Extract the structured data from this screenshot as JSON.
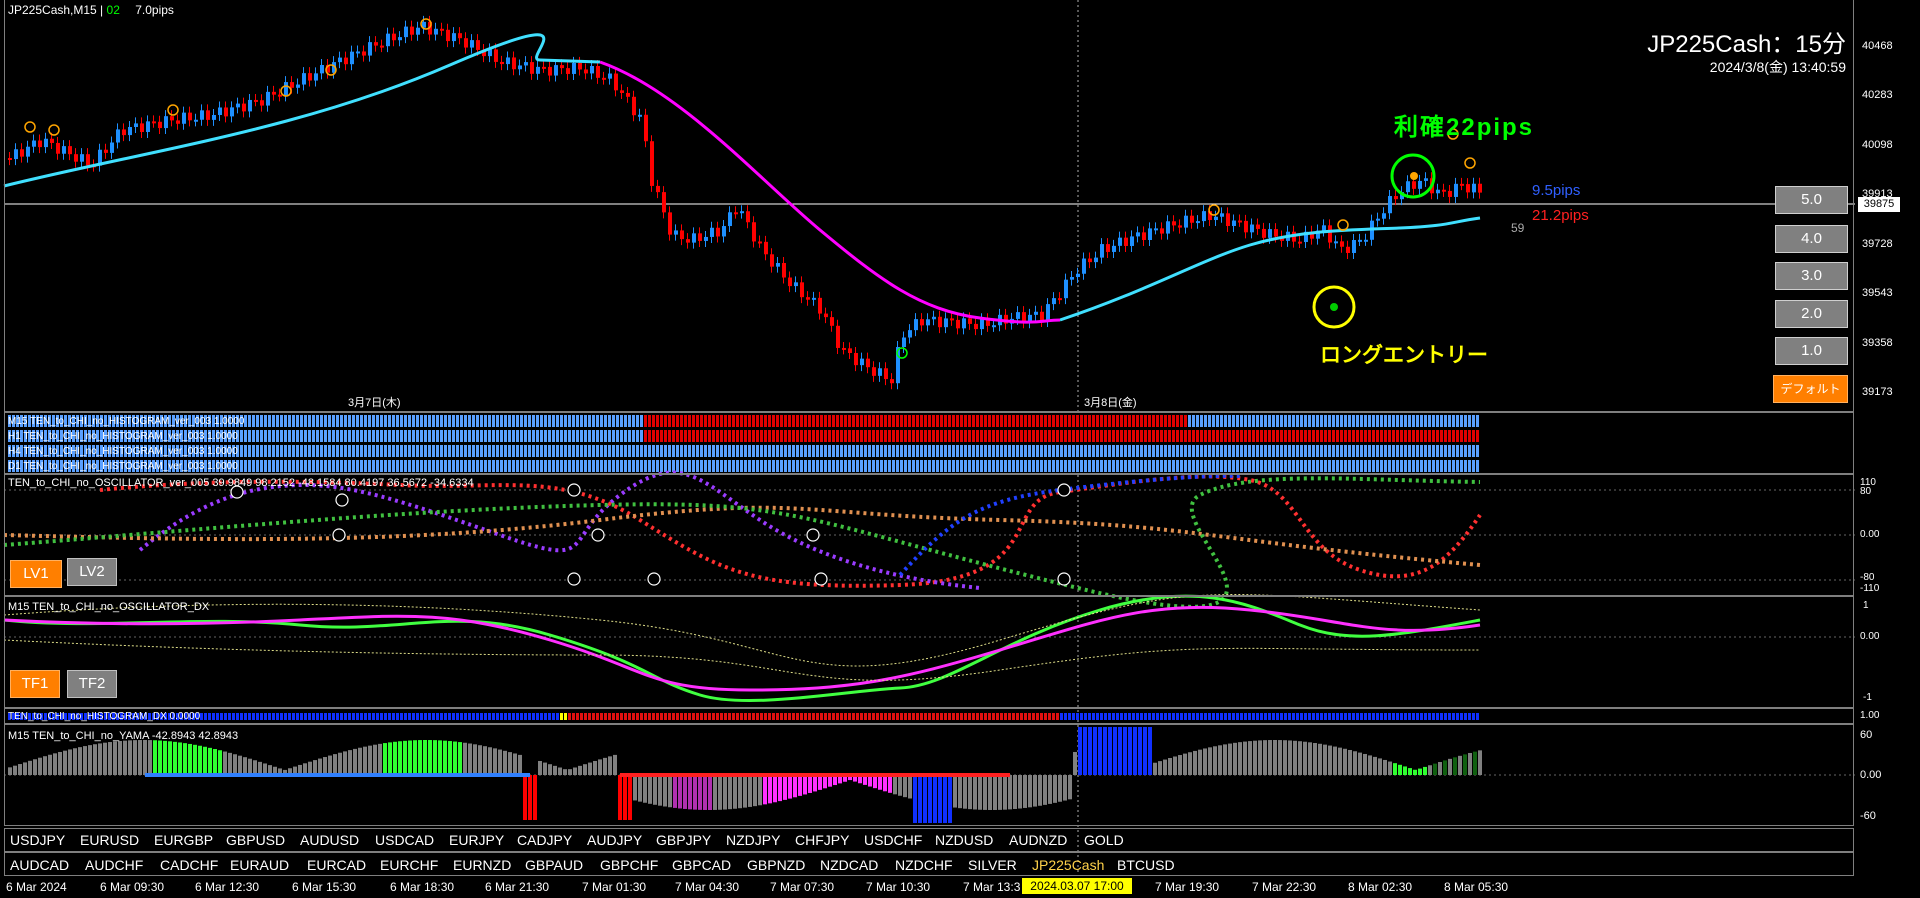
{
  "chart_header": {
    "symbol": "JP225Cash,M15",
    "bar_time": "02",
    "spread": "7.0pips"
  },
  "chart_title": {
    "title": "JP225Cash：15分",
    "datetime": "2024/3/8(金) 13:40:59"
  },
  "annotations": {
    "take_profit": "利確22pips",
    "long_entry": "ロングエントリー",
    "pips_blue": "9.5pips",
    "pips_red": "21.2pips",
    "seconds": "59"
  },
  "price_axis": {
    "labels": [
      "40468",
      "40283",
      "40098",
      "39913",
      "39728",
      "39543",
      "39358",
      "39173"
    ],
    "current_price": "39875"
  },
  "scale_buttons": [
    "5.0",
    "4.0",
    "3.0",
    "2.0",
    "1.0"
  ],
  "default_button": "デフォルト",
  "date_labels": [
    "3月7日(木)",
    "3月8日(金)"
  ],
  "histogram_rows": [
    "M15 TEN_to_CHI_no_HISTOGRAM_ver_003 1.0000",
    "H1 TEN_to_CHI_no_HISTOGRAM_ver_003 1.0000",
    "H4 TEN_to_CHI_no_HISTOGRAM_ver_003 1.0000",
    "D1 TEN_to_CHI_no_HISTOGRAM_ver_003 1.0000"
  ],
  "oscillator": {
    "title": "TEN_to_CHI_no_OSCILLATOR_ver_005 39.9849 98.2152 -48.1584 80.4197 36.5672 -34.6334",
    "levels": [
      "110",
      "80",
      "0.00",
      "-80",
      "-110"
    ],
    "buttons": [
      "LV1",
      "LV2"
    ]
  },
  "oscillator_dx": {
    "title": "M15 TEN_to_CHI_no_OSCILLATOR_DX",
    "levels": [
      "1",
      "0.00",
      "-1"
    ],
    "buttons": [
      "TF1",
      "TF2"
    ]
  },
  "histogram_dx": {
    "title": "TEN_to_CHI_no_HISTOGRAM_DX 0.0000",
    "level": "1.00"
  },
  "yama": {
    "title": "M15 TEN_to_CHI_no_YAMA -42.8943 42.8943",
    "levels": [
      "60",
      "0.00",
      "-60"
    ]
  },
  "symbols_row1": [
    "USDJPY",
    "EURUSD",
    "EURGBP",
    "GBPUSD",
    "AUDUSD",
    "USDCAD",
    "EURJPY",
    "CADJPY",
    "AUDJPY",
    "GBPJPY",
    "NZDJPY",
    "CHFJPY",
    "USDCHF",
    "NZDUSD",
    "AUDNZD",
    "GOLD"
  ],
  "symbols_row2": [
    "AUDCAD",
    "AUDCHF",
    "CADCHF",
    "EURAUD",
    "EURCAD",
    "EURCHF",
    "EURNZD",
    "GBPAUD",
    "GBPCHF",
    "GBPCAD",
    "GBPNZD",
    "NZDCAD",
    "NZDCHF",
    "SILVER",
    "JP225Cash",
    "BTCUSD"
  ],
  "time_axis": [
    "6 Mar 2024",
    "6 Mar 09:30",
    "6 Mar 12:30",
    "6 Mar 15:30",
    "6 Mar 18:30",
    "6 Mar 21:30",
    "7 Mar 01:30",
    "7 Mar 04:30",
    "7 Mar 07:30",
    "7 Mar 10:30",
    "7 Mar 13:3",
    "7 Mar 19:30",
    "7 Mar 22:30",
    "8 Mar 02:30",
    "8 Mar 05:30"
  ],
  "cursor_time": "2024.03.07 17:00",
  "colors": {
    "bull": "#1e90ff",
    "bear": "#ff0000",
    "ma_cyan": "#40e0ff",
    "ma_magenta": "#ff00ff",
    "accent_green": "#00ff00",
    "accent_yellow": "#ffff00",
    "orange": "#ff7f00"
  }
}
